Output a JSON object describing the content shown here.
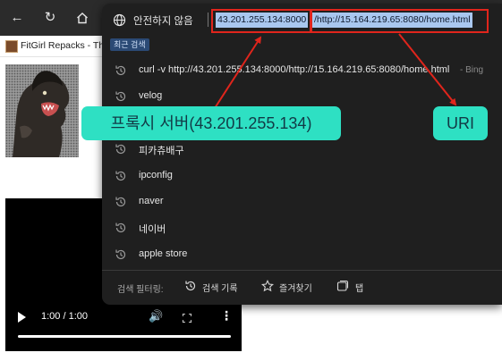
{
  "browser": {
    "bookmark_label": "FitGirl Repacks - Th..."
  },
  "omnibox": {
    "security_label": "안전하지 않음",
    "url_host": "43.201.255.134:8000",
    "url_path": "/http://15.164.219.65:8080/home.html",
    "recent_header": "최근 검색",
    "suggestions": [
      {
        "text": "curl -v http://43.201.255.134:8000/http://15.164.219.65:8080/home.html",
        "extra": " - Bing"
      },
      {
        "text": "velog",
        "extra": ""
      },
      {
        "text": "",
        "extra": ""
      },
      {
        "text": "피카츄배구",
        "extra": ""
      },
      {
        "text": "ipconfig",
        "extra": ""
      },
      {
        "text": "naver",
        "extra": ""
      },
      {
        "text": "네이버",
        "extra": ""
      },
      {
        "text": "apple store",
        "extra": ""
      }
    ],
    "filter_label": "검색 필터링:",
    "filter_history": "검색 기록",
    "filter_favorites": "즐겨찾기",
    "filter_tabs": "탭"
  },
  "video": {
    "time": "1:00 / 1:00"
  },
  "annotations": {
    "proxy_label": "프록시 서버(43.201.255.134)",
    "uri_label": "URI",
    "color": "#e0251c",
    "label_color": "#2ee0c3"
  },
  "icons": {
    "back": "back-arrow-icon",
    "reload": "reload-icon",
    "home": "home-icon",
    "site": "globe-icon",
    "history": "history-icon",
    "favorites": "star-icon",
    "tabs": "tabs-icon"
  }
}
